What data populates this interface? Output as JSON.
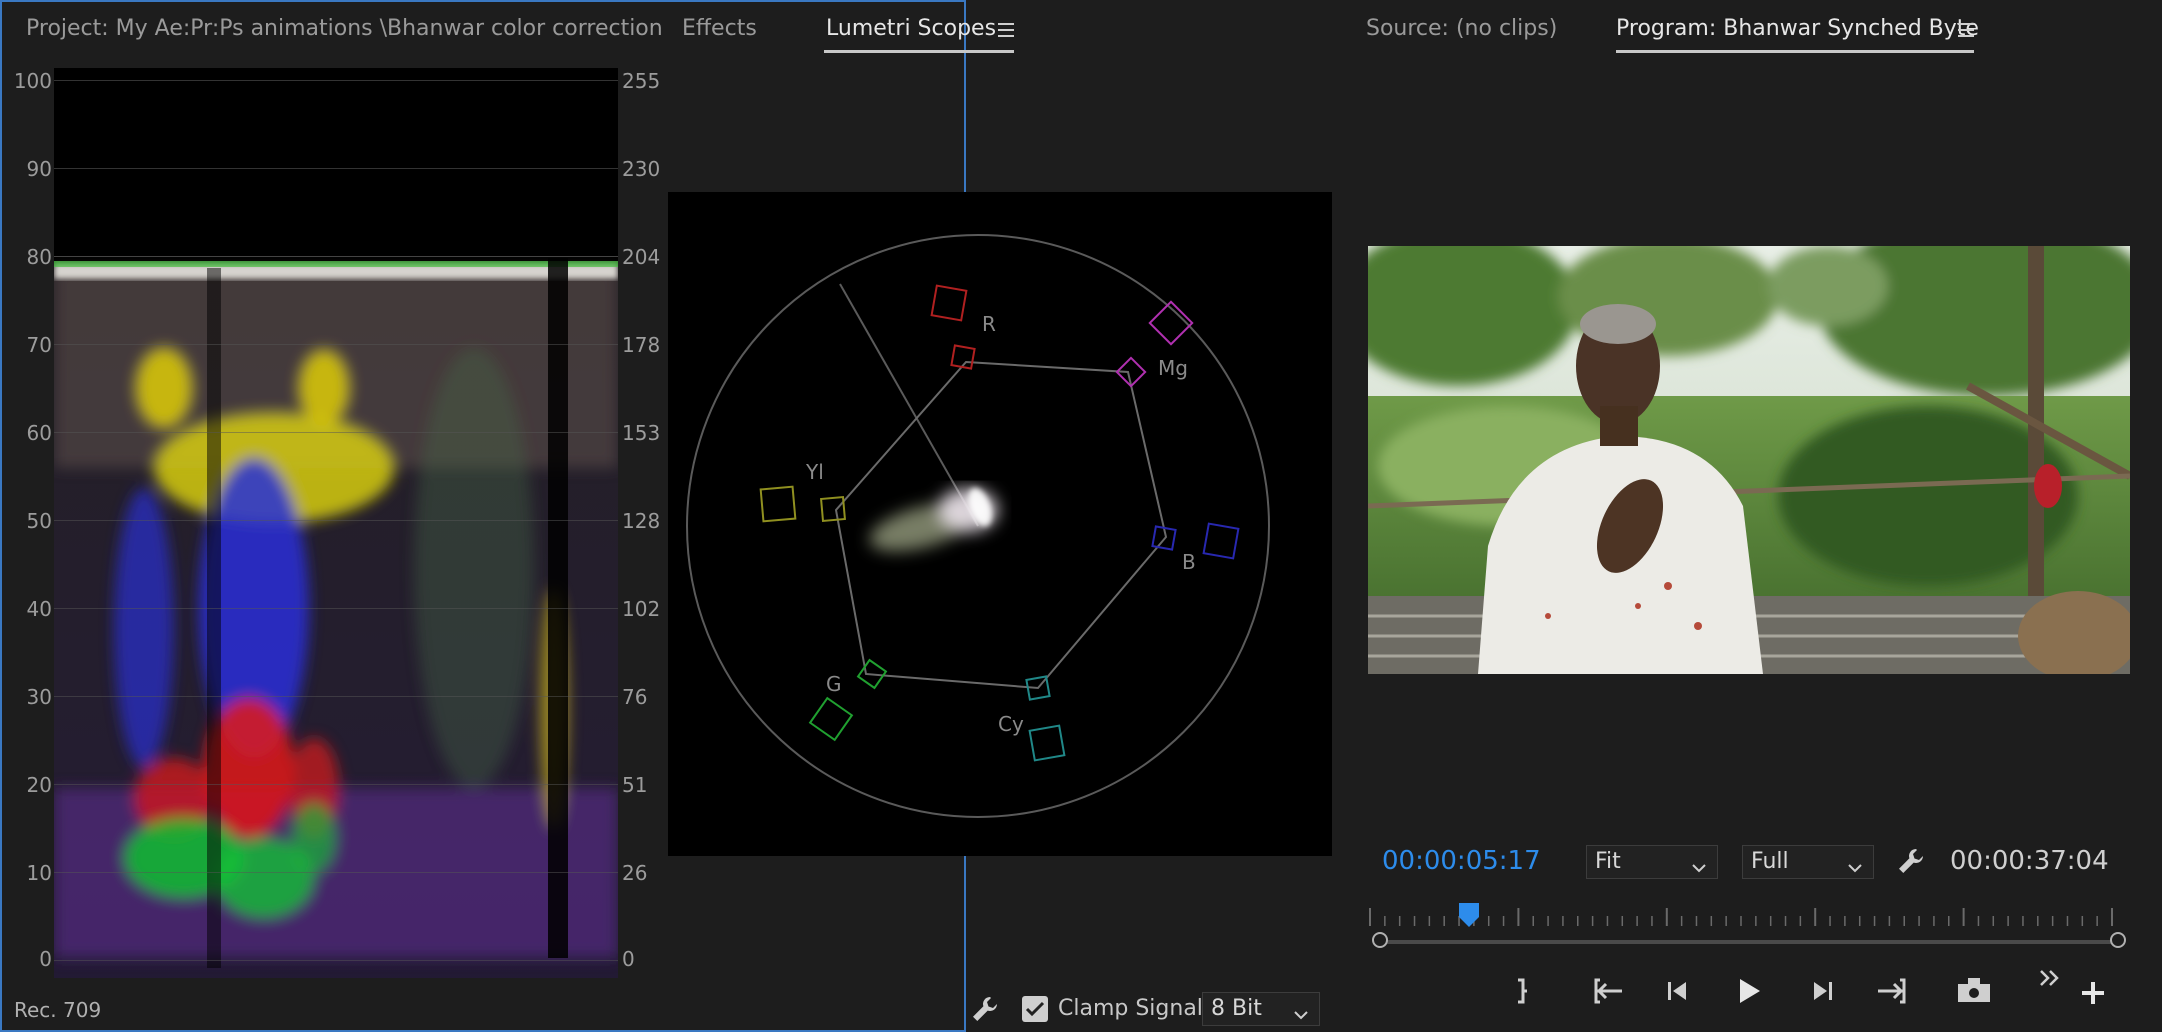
{
  "left_panel": {
    "tabs": [
      {
        "label": "Project: My Ae:Pr:Ps animations \\Bhanwar color correction",
        "active": false
      },
      {
        "label": "Effects",
        "active": false
      },
      {
        "label": "Lumetri Scopes",
        "active": true
      }
    ],
    "waveform": {
      "left_ticks": [
        "100",
        "90",
        "80",
        "70",
        "60",
        "50",
        "40",
        "30",
        "20",
        "10",
        "0"
      ],
      "right_ticks": [
        "255",
        "230",
        "204",
        "178",
        "153",
        "128",
        "102",
        "76",
        "51",
        "26",
        "0"
      ]
    },
    "vectorscope": {
      "targets": [
        "R",
        "Mg",
        "B",
        "Cy",
        "G",
        "Yl"
      ]
    },
    "footer": {
      "color_space": "Rec. 709",
      "clamp_label": "Clamp Signal",
      "clamp_checked": true,
      "bit_depth": "8 Bit"
    }
  },
  "right_panel": {
    "tabs": [
      {
        "label": "Source: (no clips)",
        "active": false
      },
      {
        "label": "Program: Bhanwar Synched Byte",
        "active": true
      }
    ],
    "timecode_current": "00:00:05:17",
    "timecode_duration": "00:00:37:04",
    "zoom_select": "Fit",
    "resolution_select": "Full",
    "playhead_fraction": 0.136,
    "accent_color": "#2d8ceb"
  },
  "icons": [
    "hamburger-menu-icon",
    "wrench-icon",
    "checkbox-icon",
    "chevron-down-icon",
    "mark-out-icon",
    "go-to-in-icon",
    "step-back-icon",
    "play-icon",
    "step-forward-icon",
    "go-to-out-icon",
    "export-frame-icon",
    "button-editor-icon",
    "add-icon"
  ]
}
